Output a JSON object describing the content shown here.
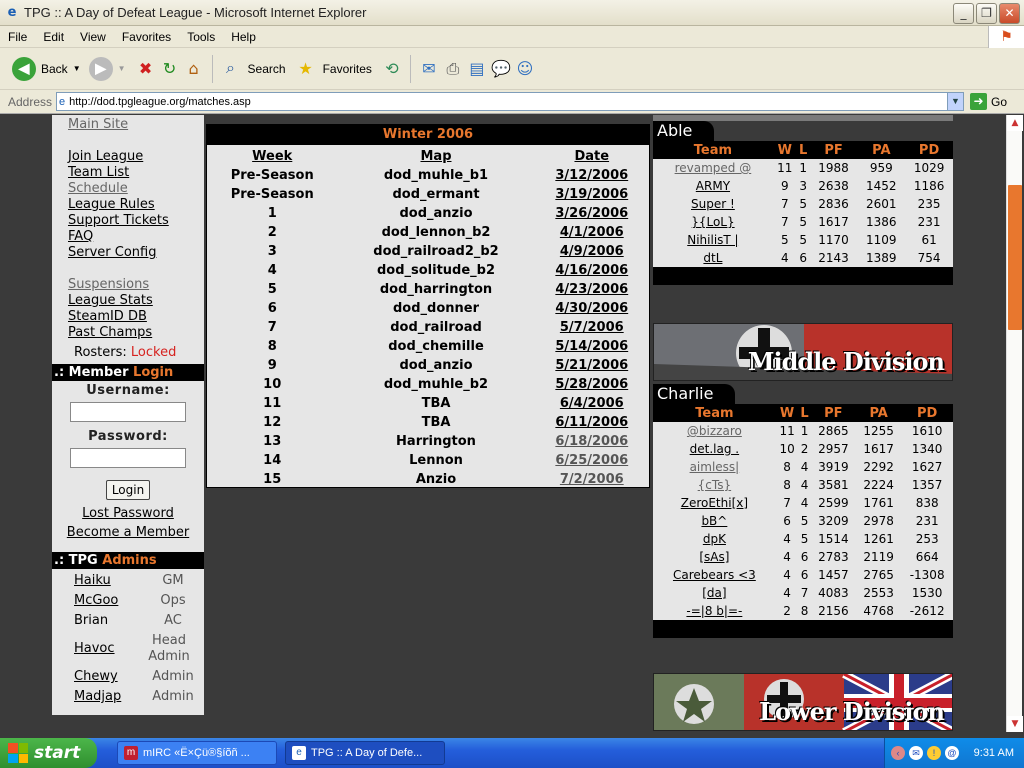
{
  "window": {
    "title": "TPG :: A Day of Defeat League - Microsoft Internet Explorer"
  },
  "menu": [
    "File",
    "Edit",
    "View",
    "Favorites",
    "Tools",
    "Help"
  ],
  "toolbar": {
    "back": "Back",
    "search": "Search",
    "favorites": "Favorites"
  },
  "address": {
    "label": "Address",
    "url": "http://dod.tpgleague.org/matches.asp",
    "go": "Go"
  },
  "nav": {
    "main_site": "Main Site",
    "join_league": "Join League",
    "team_list": "Team List",
    "schedule": "Schedule",
    "league_rules": "League Rules",
    "support_tickets": "Support Tickets",
    "faq": "FAQ",
    "server_config": "Server Config",
    "suspensions": "Suspensions",
    "league_stats": "League Stats",
    "steamid_db": "SteamID DB",
    "past_champs": "Past Champs",
    "rosters_label": "Rosters:",
    "rosters_status": "Locked"
  },
  "member": {
    "prefix": ".: Member",
    "accent": "Login",
    "username_label": "Username:",
    "password_label": "Password:",
    "login_button": "Login",
    "lost_password": "Lost Password",
    "become_member": "Become a Member"
  },
  "admins": {
    "prefix": ".: TPG",
    "accent": "Admins",
    "list": [
      {
        "name": "Haiku",
        "role": "GM"
      },
      {
        "name": "McGoo",
        "role": "Ops"
      },
      {
        "name": "Brian",
        "role": "AC"
      },
      {
        "name": "Havoc",
        "role": "Head Admin"
      },
      {
        "name": "Chewy",
        "role": "Admin"
      },
      {
        "name": "Madjap",
        "role": "Admin"
      }
    ]
  },
  "schedule": {
    "title": "Winter 2006",
    "headers": [
      "Week",
      "Map",
      "Date"
    ],
    "rows": [
      [
        "Pre-Season",
        "dod_muhle_b1",
        "3/12/2006"
      ],
      [
        "Pre-Season",
        "dod_ermant",
        "3/19/2006"
      ],
      [
        "1",
        "dod_anzio",
        "3/26/2006"
      ],
      [
        "2",
        "dod_lennon_b2",
        "4/1/2006"
      ],
      [
        "3",
        "dod_railroad2_b2",
        "4/9/2006"
      ],
      [
        "4",
        "dod_solitude_b2",
        "4/16/2006"
      ],
      [
        "5",
        "dod_harrington",
        "4/23/2006"
      ],
      [
        "6",
        "dod_donner",
        "4/30/2006"
      ],
      [
        "7",
        "dod_railroad",
        "5/7/2006"
      ],
      [
        "8",
        "dod_chemille",
        "5/14/2006"
      ],
      [
        "9",
        "dod_anzio",
        "5/21/2006"
      ],
      [
        "10",
        "dod_muhle_b2",
        "5/28/2006"
      ],
      [
        "11",
        "TBA",
        "6/4/2006"
      ],
      [
        "12",
        "TBA",
        "6/11/2006"
      ],
      [
        "13",
        "Harrington",
        "6/18/2006"
      ],
      [
        "14",
        "Lennon",
        "6/25/2006"
      ],
      [
        "15",
        "Anzio",
        "7/2/2006"
      ]
    ]
  },
  "standings_headers": [
    "Team",
    "W",
    "L",
    "PF",
    "PA",
    "PD"
  ],
  "divisions": {
    "able": {
      "name": "Able",
      "rows": [
        [
          "revamped @",
          "11",
          "1",
          "1988",
          "959",
          "1029"
        ],
        [
          "ARMY",
          "9",
          "3",
          "2638",
          "1452",
          "1186"
        ],
        [
          "Super !",
          "7",
          "5",
          "2836",
          "2601",
          "235"
        ],
        [
          "}{LoL}",
          "7",
          "5",
          "1617",
          "1386",
          "231"
        ],
        [
          "NihilisT |",
          "5",
          "5",
          "1170",
          "1109",
          "61"
        ],
        [
          "dtL",
          "4",
          "6",
          "2143",
          "1389",
          "754"
        ]
      ]
    },
    "middle_banner": "Middle Division",
    "charlie": {
      "name": "Charlie",
      "rows": [
        [
          "@bizzaro",
          "11",
          "1",
          "2865",
          "1255",
          "1610"
        ],
        [
          "det.lag .",
          "10",
          "2",
          "2957",
          "1617",
          "1340"
        ],
        [
          "aimless|",
          "8",
          "4",
          "3919",
          "2292",
          "1627"
        ],
        [
          "{cTs}",
          "8",
          "4",
          "3581",
          "2224",
          "1357"
        ],
        [
          "ZeroEthi[x]",
          "7",
          "4",
          "2599",
          "1761",
          "838"
        ],
        [
          "bB^",
          "6",
          "5",
          "3209",
          "2978",
          "231"
        ],
        [
          "dpK",
          "4",
          "5",
          "1514",
          "1261",
          "253"
        ],
        [
          "[sAs]",
          "4",
          "6",
          "2783",
          "2119",
          "664"
        ],
        [
          "Carebears <3",
          "4",
          "6",
          "1457",
          "2765",
          "-1308"
        ],
        [
          "[da]",
          "4",
          "7",
          "4083",
          "2553",
          "1530"
        ],
        [
          "-=|8 b|=-",
          "2",
          "8",
          "2156",
          "4768",
          "-2612"
        ]
      ]
    },
    "lower_banner": "Lower Division"
  },
  "taskbar": {
    "start": "start",
    "tasks": [
      "mIRC «Ë×Çü®§íõñ ...",
      "TPG :: A Day of Defe..."
    ],
    "clock": "9:31 AM"
  },
  "colors": {
    "accent_orange": "#e8772e",
    "locked_red": "#d6221f",
    "panel_gray": "#e6e6e6",
    "page_bg": "#3a3a3a"
  }
}
